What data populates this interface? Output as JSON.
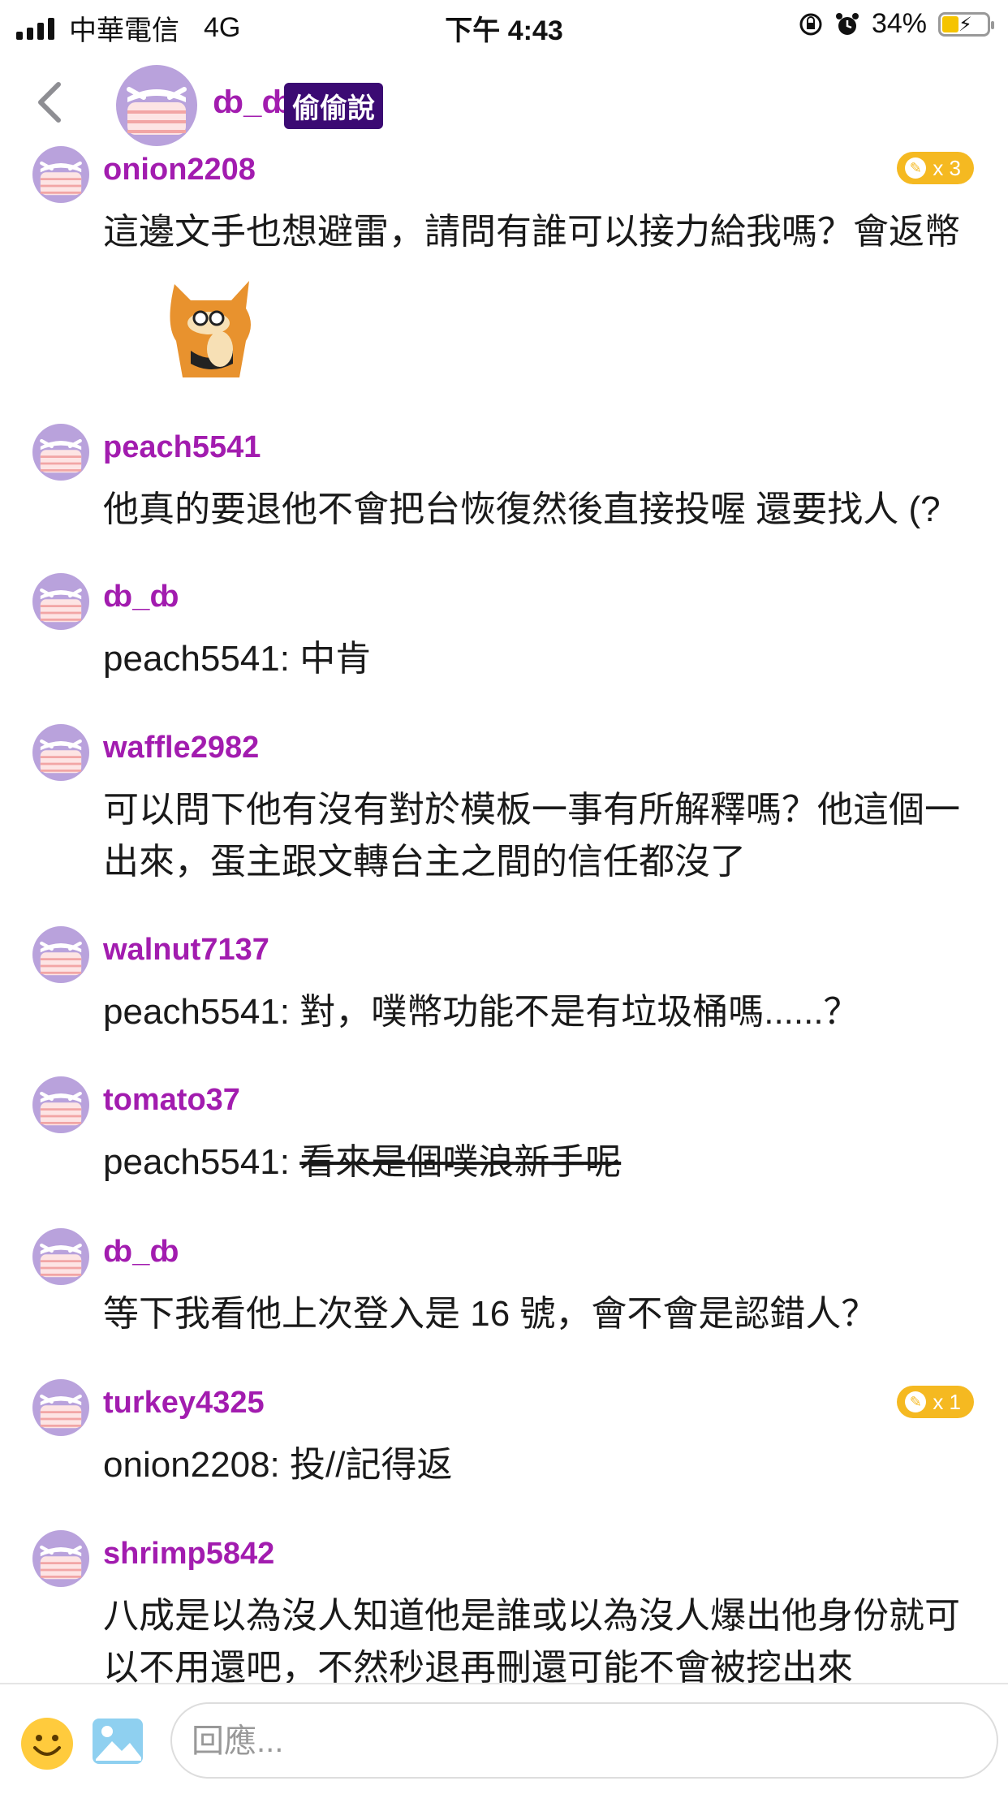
{
  "status_bar": {
    "carrier": "中華電信",
    "network": "4G",
    "time": "下午 4:43",
    "battery": "34%"
  },
  "header": {
    "name": "ȸ_ȸ",
    "badge": "偷偷說"
  },
  "messages": [
    {
      "user": "onion2208",
      "text": "這邊文手也想避雷，請問有誰可以接力給我嗎？會返幣",
      "coin": "x 3"
    },
    {
      "user": "peach5541",
      "text": "他真的要退他不會把台恢復然後直接投喔 還要找人 (?"
    },
    {
      "user": "ȸ_ȸ",
      "text": "peach5541: 中肯"
    },
    {
      "user": "waffle2982",
      "text": "可以問下他有沒有對於模板一事有所解釋嗎？他這個一出來，蛋主跟文轉台主之間的信任都沒了"
    },
    {
      "user": "walnut7137",
      "text": "peach5541: 對，噗幣功能不是有垃圾桶嗎......？"
    },
    {
      "user": "tomato37",
      "prefix": "peach5541: ",
      "strike": "看來是個噗浪新手呢"
    },
    {
      "user": "ȸ_ȸ",
      "text": "等下我看他上次登入是 16 號，會不會是認錯人？"
    },
    {
      "user": "turkey4325",
      "text": "onion2208: 投//記得返",
      "coin": "x 1"
    },
    {
      "user": "shrimp5842",
      "text": "八成是以為沒人知道他是誰或以為沒人爆出他身份就可以不用還吧，不然秒退再刪還可能不會被挖出來"
    }
  ],
  "reply": {
    "placeholder": "回應..."
  },
  "icons": [
    "back-icon",
    "avatar-icon",
    "coin-icon",
    "smiley-icon",
    "image-icon",
    "signal-icon",
    "battery-icon",
    "alarm-icon",
    "lock-rotation-icon"
  ]
}
